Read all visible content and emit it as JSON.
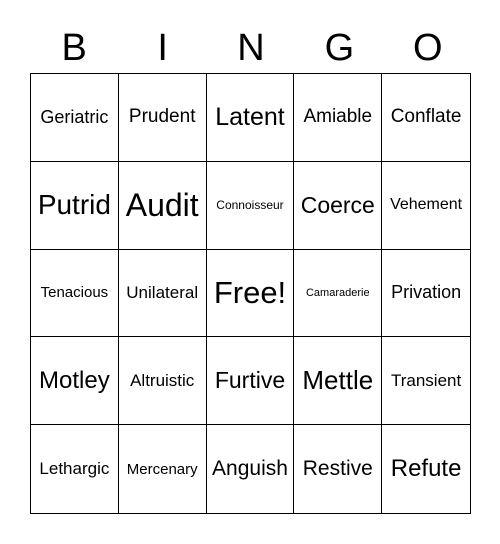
{
  "header": [
    "B",
    "I",
    "N",
    "G",
    "O"
  ],
  "cells": [
    {
      "text": "Geriatric",
      "size": 18
    },
    {
      "text": "Prudent",
      "size": 19
    },
    {
      "text": "Latent",
      "size": 25
    },
    {
      "text": "Amiable",
      "size": 19
    },
    {
      "text": "Conflate",
      "size": 19
    },
    {
      "text": "Putrid",
      "size": 28
    },
    {
      "text": "Audit",
      "size": 32
    },
    {
      "text": "Connoisseur",
      "size": 12
    },
    {
      "text": "Coerce",
      "size": 23
    },
    {
      "text": "Vehement",
      "size": 16
    },
    {
      "text": "Tenacious",
      "size": 15
    },
    {
      "text": "Unilateral",
      "size": 17
    },
    {
      "text": "Free!",
      "size": 31
    },
    {
      "text": "Camaraderie",
      "size": 11
    },
    {
      "text": "Privation",
      "size": 18
    },
    {
      "text": "Motley",
      "size": 24
    },
    {
      "text": "Altruistic",
      "size": 17
    },
    {
      "text": "Furtive",
      "size": 23
    },
    {
      "text": "Mettle",
      "size": 26
    },
    {
      "text": "Transient",
      "size": 17
    },
    {
      "text": "Lethargic",
      "size": 17
    },
    {
      "text": "Mercenary",
      "size": 15
    },
    {
      "text": "Anguish",
      "size": 21
    },
    {
      "text": "Restive",
      "size": 21
    },
    {
      "text": "Refute",
      "size": 24
    }
  ]
}
